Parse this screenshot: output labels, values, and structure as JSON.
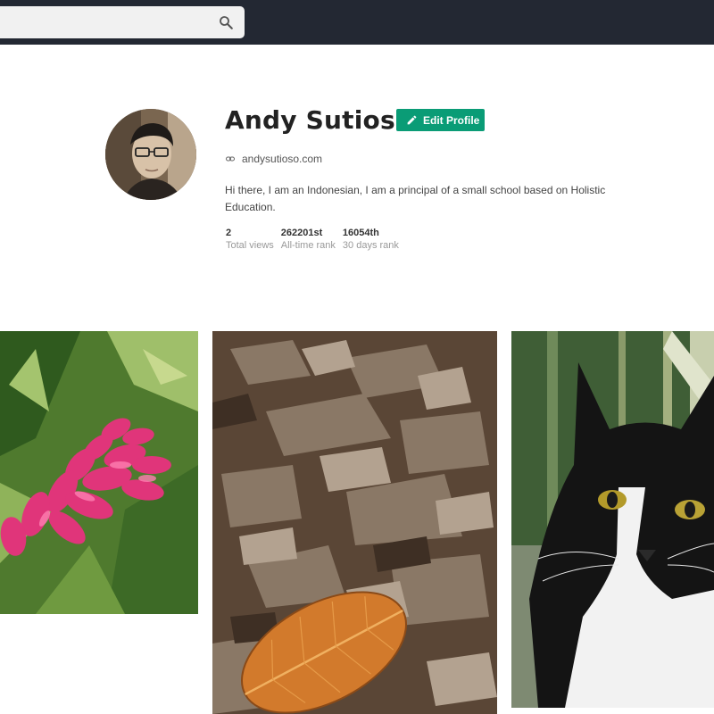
{
  "header": {
    "search": {
      "value": "",
      "placeholder": "",
      "icon": "search-icon"
    }
  },
  "profile": {
    "name": "Andy Sutioso",
    "edit_label": "Edit Profile",
    "website": "andysutioso.com",
    "bio": "Hi there, I am an Indonesian, I am a principal of a small school based on Holistic Education.",
    "stats": [
      {
        "value": "2",
        "label": "Total views"
      },
      {
        "value": "262201st",
        "label": "All-time rank"
      },
      {
        "value": "16054th",
        "label": "30 days rank"
      }
    ]
  },
  "photos": [
    "pink flower",
    "fallen leaves",
    "black and white cat"
  ],
  "colors": {
    "topbar": "#232833",
    "accent": "#0a9c76"
  }
}
